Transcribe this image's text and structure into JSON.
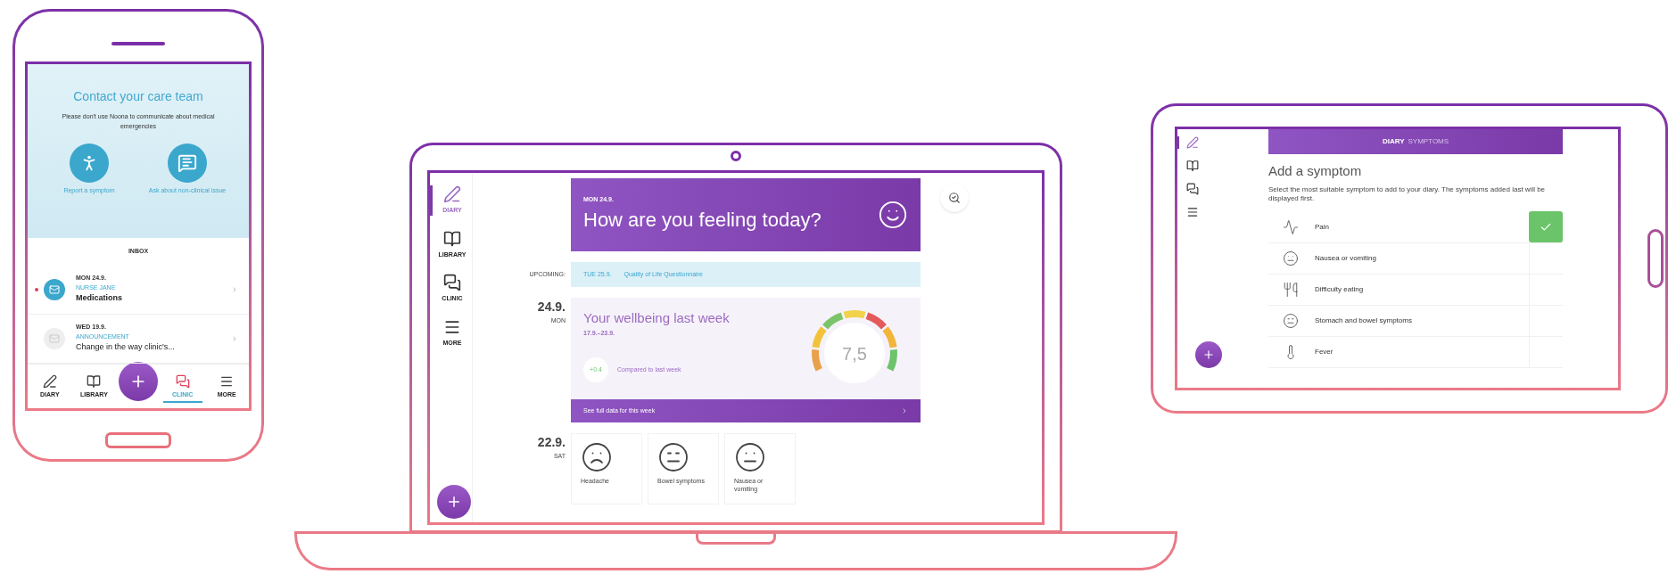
{
  "phone": {
    "contact": {
      "title": "Contact your care team",
      "note": "Please don't use Noona to communicate about medical emergencies",
      "actions": [
        {
          "kind": "symptom",
          "label": "Report a symptom"
        },
        {
          "kind": "question",
          "label": "Ask about non-clinical issue"
        }
      ]
    },
    "inbox": {
      "title": "INBOX",
      "messages": [
        {
          "date": "MON 24.9.",
          "sender": "NURSE JANE",
          "subject": "Medications",
          "unread": true
        },
        {
          "date": "WED 19.9.",
          "sender": "ANNOUNCEMENT",
          "subject": "Change in the way clinic's...",
          "unread": false
        }
      ]
    },
    "nav": [
      {
        "kind": "diary",
        "label": "DIARY",
        "selected": false
      },
      {
        "kind": "library",
        "label": "LIBRARY",
        "selected": false
      },
      {
        "kind": "clinic",
        "label": "CLINIC",
        "selected": true
      },
      {
        "kind": "more",
        "label": "MORE",
        "selected": false
      }
    ]
  },
  "laptop": {
    "sidebar": [
      {
        "kind": "diary",
        "label": "DIARY",
        "selected": true
      },
      {
        "kind": "library",
        "label": "LIBRARY",
        "selected": false
      },
      {
        "kind": "clinic",
        "label": "CLINIC",
        "selected": false
      },
      {
        "kind": "more",
        "label": "MORE",
        "selected": false
      }
    ],
    "header": {
      "date": "MON 24.9.",
      "question": "How are you feeling today?"
    },
    "upcoming": {
      "label": "UPCOMING:",
      "date": "TUE 25.9.",
      "title": "Quality of Life Questionnaire"
    },
    "days": [
      {
        "kind": "wellbeing",
        "date": "24.9.",
        "weekday": "MON",
        "title": "Your wellbeing last week",
        "range": "17.9.–23.9.",
        "change": "+0.4",
        "comparison": "Compared to last week",
        "score": "7,5",
        "link": "See full data for this week"
      },
      {
        "kind": "symptoms",
        "date": "22.9.",
        "weekday": "SAT",
        "items": [
          {
            "kind": "head",
            "label": "Headache"
          },
          {
            "kind": "bowel",
            "label": "Bowel symptoms"
          },
          {
            "kind": "nausea",
            "label": "Nausea or vomiting"
          }
        ]
      }
    ]
  },
  "tablet": {
    "sidebar": [
      {
        "kind": "diary",
        "selected": true
      },
      {
        "kind": "library",
        "selected": false
      },
      {
        "kind": "clinic",
        "selected": false
      },
      {
        "kind": "more",
        "selected": false
      }
    ],
    "header": [
      {
        "label": "DIARY",
        "selected": true
      },
      {
        "label": "SYMPTOMS",
        "selected": false
      }
    ],
    "title": "Add a symptom",
    "description": "Select the most suitable symptom to add to your diary. The symptoms added last will be displayed first.",
    "symptoms": [
      {
        "label": "Pain",
        "selected": true
      },
      {
        "label": "Nausea or vomiting",
        "selected": false
      },
      {
        "label": "Difficulty eating",
        "selected": false
      },
      {
        "label": "Stomach and bowel symptoms",
        "selected": false
      },
      {
        "label": "Fever",
        "selected": false
      }
    ]
  }
}
